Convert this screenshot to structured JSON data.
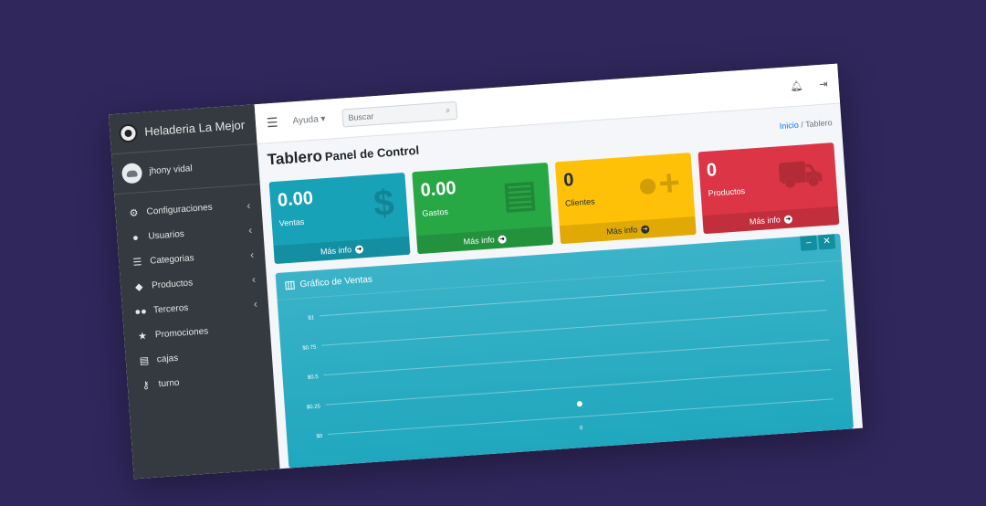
{
  "brand": {
    "name": "Heladeria La Mejor"
  },
  "user": {
    "name": "jhony vidal"
  },
  "sidebar": {
    "items": [
      {
        "label": "Configuraciones",
        "icon": "gear-icon",
        "expandable": true
      },
      {
        "label": "Usuarios",
        "icon": "user-icon",
        "expandable": true
      },
      {
        "label": "Categorias",
        "icon": "list-icon",
        "expandable": true
      },
      {
        "label": "Productos",
        "icon": "tags-icon",
        "expandable": true
      },
      {
        "label": "Terceros",
        "icon": "users-icon",
        "expandable": true
      },
      {
        "label": "Promociones",
        "icon": "star-icon",
        "expandable": false
      },
      {
        "label": "cajas",
        "icon": "cash-register-icon",
        "expandable": false
      },
      {
        "label": "turno",
        "icon": "key-icon",
        "expandable": false
      }
    ]
  },
  "topnav": {
    "help_label": "Ayuda",
    "search_placeholder": "Buscar"
  },
  "header": {
    "title": "Tablero",
    "subtitle": "Panel de Control",
    "breadcrumb_home": "Inicio",
    "breadcrumb_current": "Tablero"
  },
  "boxes": [
    {
      "value": "0.00",
      "label": "Ventas",
      "more": "Más info",
      "icon": "dollar-icon",
      "color": "#17a2b8"
    },
    {
      "value": "0.00",
      "label": "Gastos",
      "more": "Más info",
      "icon": "clipboard-icon",
      "color": "#28a745"
    },
    {
      "value": "0",
      "label": "Clientes",
      "more": "Más info",
      "icon": "user-plus-icon",
      "color": "#ffc107"
    },
    {
      "value": "0",
      "label": "Productos",
      "more": "Más info",
      "icon": "cart-icon",
      "color": "#dc3545"
    }
  ],
  "chart_card": {
    "title": "Gráfico de Ventas"
  },
  "chart_data": {
    "type": "line",
    "title": "",
    "xlabel": "",
    "ylabel": "",
    "x": [
      "0"
    ],
    "series": [
      {
        "values": [
          0
        ]
      }
    ],
    "y_ticks": [
      "$1",
      "$0.75",
      "$0.5",
      "$0.25",
      "$0"
    ],
    "ylim": [
      0,
      1
    ],
    "grid": true
  }
}
